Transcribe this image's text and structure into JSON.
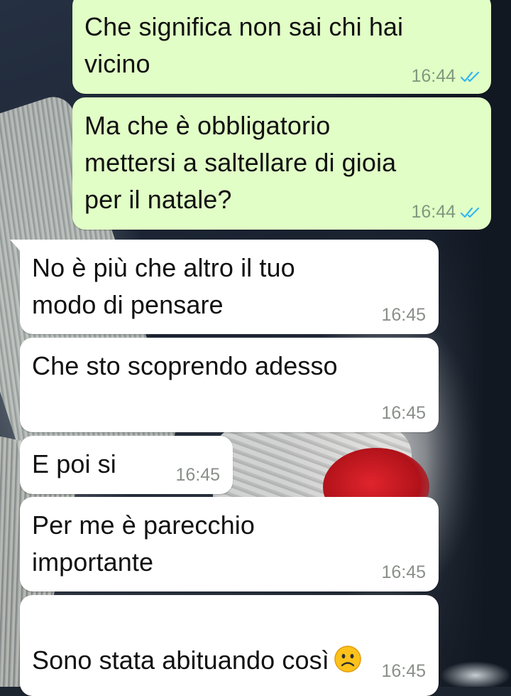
{
  "colors": {
    "outgoing_bubble": "#e1fec6",
    "incoming_bubble": "#ffffff",
    "read_ticks": "#34b7f1"
  },
  "messages": [
    {
      "direction": "outgoing",
      "text": "Che significa non sai chi hai\nvicino",
      "time": "16:44",
      "status": "read-double-tick-icon"
    },
    {
      "direction": "outgoing",
      "text": "Ma che è obbligatorio\nmettersi a saltellare di gioia\nper il natale?",
      "time": "16:44",
      "status": "read-double-tick-icon"
    },
    {
      "direction": "incoming",
      "text": "No è più che altro il tuo\nmodo di pensare",
      "time": "16:45"
    },
    {
      "direction": "incoming",
      "text": "Che sto scoprendo adesso",
      "time": "16:45"
    },
    {
      "direction": "incoming",
      "text": "E poi si",
      "time": "16:45"
    },
    {
      "direction": "incoming",
      "text": "Per me è parecchio\nimportante",
      "time": "16:45"
    },
    {
      "direction": "incoming",
      "text": "Sono stata abituando così",
      "emoji": "frowning-face-icon",
      "time": "16:45"
    }
  ]
}
